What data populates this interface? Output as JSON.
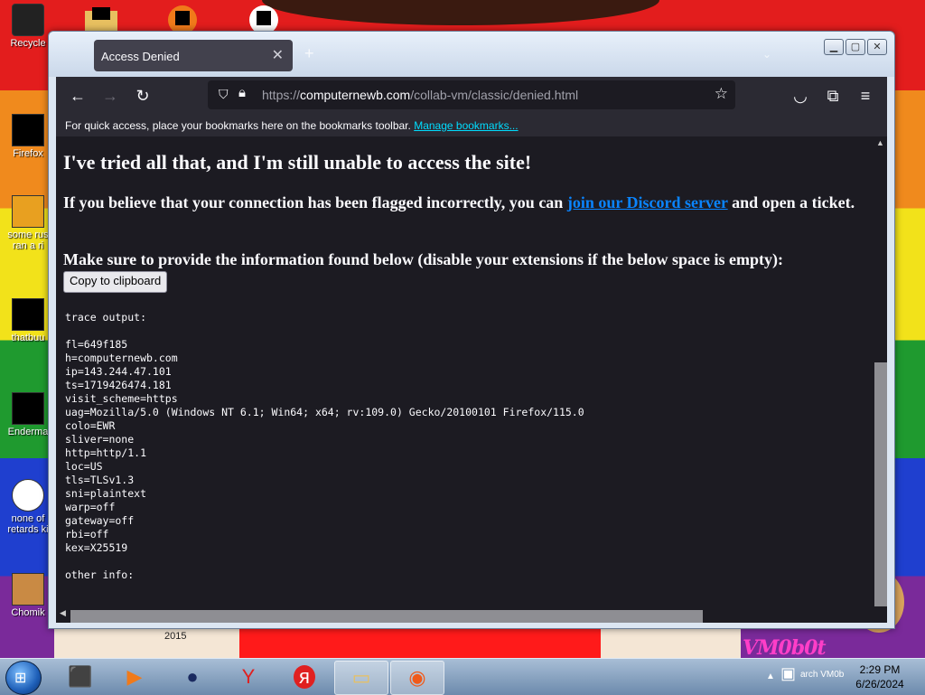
{
  "desktop": {
    "icons": [
      {
        "label": "Recycle"
      },
      {
        "label": "Firefox"
      },
      {
        "label": "some rus"
      },
      {
        "label": "ran a ri"
      },
      {
        "label": "thatbuu"
      },
      {
        "label": "Enderma"
      },
      {
        "label": "none of"
      },
      {
        "label": "retards ki"
      },
      {
        "label": "Chomik"
      }
    ],
    "wallpaper_text": "2015",
    "watermark": "VM0b0t"
  },
  "browser": {
    "tab": {
      "title": "Access Denied"
    },
    "url": {
      "prefix": "https://",
      "host": "computernewb.com",
      "path": "/collab-vm/classic/denied.html"
    },
    "bookmarks_bar": {
      "message": "For quick access, place your bookmarks here on the bookmarks toolbar.",
      "link": "Manage bookmarks..."
    }
  },
  "page": {
    "heading": "I've tried all that, and I'm still unable to access the site!",
    "paragraph1_before": "If you believe that your connection has been flagged incorrectly, you can ",
    "paragraph1_link": "join our Discord server",
    "paragraph1_after": " and open a ticket.",
    "paragraph2": "Make sure to provide the information found below (disable your extensions if the below space is empty):",
    "copy_button": "Copy to clipboard",
    "trace_title": "trace output:",
    "trace_lines": [
      "fl=649f185",
      "h=computernewb.com",
      "ip=143.244.47.101",
      "ts=1719426474.181",
      "visit_scheme=https",
      "uag=Mozilla/5.0 (Windows NT 6.1; Win64; x64; rv:109.0) Gecko/20100101 Firefox/115.0",
      "colo=EWR",
      "sliver=none",
      "http=http/1.1",
      "loc=US",
      "tls=TLSv1.3",
      "sni=plaintext",
      "warp=off",
      "gateway=off",
      "rbi=off",
      "kex=X25519"
    ],
    "other_title": "other info:"
  },
  "taskbar": {
    "tray_text": "arch VM0b",
    "time": "2:29 PM",
    "date": "6/26/2024"
  }
}
